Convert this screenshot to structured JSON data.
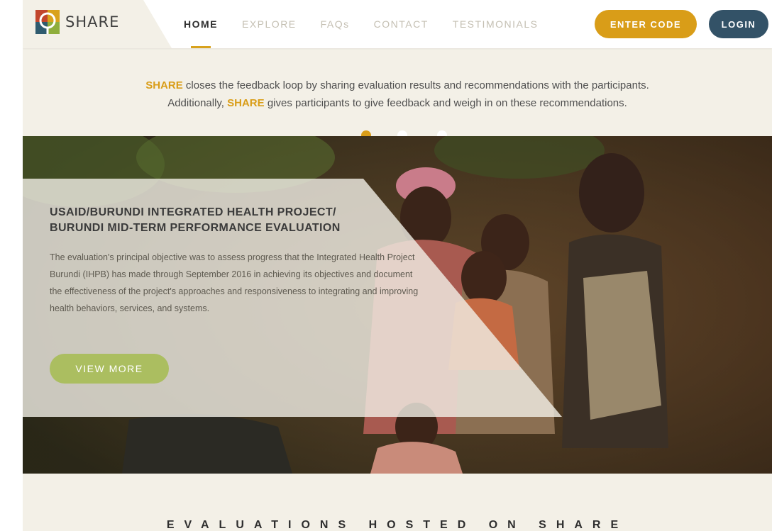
{
  "header": {
    "logo_text": "SHARE",
    "nav": [
      {
        "label": "HOME",
        "active": true
      },
      {
        "label": "EXPLORE",
        "active": false
      },
      {
        "label": "FAQs",
        "active": false
      },
      {
        "label": "CONTACT",
        "active": false
      },
      {
        "label": "TESTIMONIALS",
        "active": false
      }
    ],
    "enter_code_label": "ENTER CODE",
    "login_label": "LOGIN"
  },
  "intro": {
    "brand": "SHARE",
    "line1_rest": " closes the feedback loop by sharing evaluation results and recommendations with the participants.",
    "line2_start": "Additionally, ",
    "line2_rest": " gives participants to give feedback and weigh in on these recommendations."
  },
  "carousel": {
    "slide_count": 3,
    "active_index": 0
  },
  "hero": {
    "title_line1": "USAID/BURUNDI INTEGRATED HEALTH PROJECT/",
    "title_line2": "BURUNDI MID-TERM PERFORMANCE EVALUATION",
    "body": "The evaluation's principal objective was to assess progress that the Integrated Health Project Burundi (IHPB) has made through September 2016 in achieving its objectives and document the effectiveness of the project's approaches and responsiveness to integrating and improving health behaviors, services, and systems.",
    "button_label": "VIEW MORE"
  },
  "section": {
    "title": "EVALUATIONS HOSTED ON SHARE"
  },
  "colors": {
    "accent_gold": "#d99d18",
    "login_blue": "#335267",
    "view_more_green": "#abbe60",
    "background": "#f3f0e7"
  }
}
